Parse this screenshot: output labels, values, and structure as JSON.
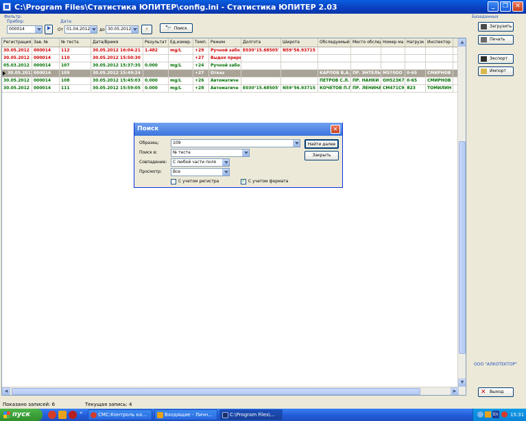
{
  "window": {
    "title": "C:\\Program Files\\Статистика ЮПИТЕР\\config.ini - Статистика ЮПИТЕР 2.03"
  },
  "filters": {
    "filter_label": "Фильтр:",
    "device_label": "Прибор:",
    "device_value": "000014",
    "date_label": "Дата:",
    "from_label": "От",
    "from_value": "01.04.2012",
    "to_label": "до",
    "to_value": "30.05.2012",
    "search_button": "Поиск"
  },
  "grid": {
    "columns": [
      "Регистрация",
      "Зав. №",
      "№ теста",
      "Дата/Время",
      "Результат",
      "Ед.измер.",
      "Темп.",
      "Режим",
      "Долгота",
      "Широта",
      "Обследуемый",
      "Место обслед.",
      "Номер ма",
      "Нагрузк",
      "Инспектор"
    ],
    "rows": [
      {
        "style": "red",
        "cells": [
          "30.05.2012",
          "000014",
          "112",
          "30.05.2012 16:04:21",
          "1.482",
          "mg/L",
          "+29",
          "Ручной забо",
          "E030°15.68505'",
          "N59°56.93715",
          "",
          "",
          "",
          "",
          ""
        ]
      },
      {
        "style": "red",
        "cells": [
          "30.05.2012",
          "000014",
          "110",
          "30.05.2012 15:50:30",
          "",
          "",
          "+27",
          "Выдох прерв",
          "",
          "",
          "",
          "",
          "",
          "",
          ""
        ]
      },
      {
        "style": "green",
        "cells": [
          "05.03.2012",
          "000014",
          "107",
          "30.05.2012 15:37:35",
          "0.000",
          "mg/L",
          "+24",
          "Ручной забо",
          "",
          "",
          "",
          "",
          "",
          "",
          ""
        ]
      },
      {
        "style": "selected",
        "cells": [
          "30.05.2012",
          "000014",
          "109",
          "30.05.2012 15:49:24",
          "",
          "",
          "+27",
          "Отказ",
          "",
          "",
          "КАРПОВ В.А.",
          "ПР. ЭНТЕЛЬ",
          "М570ОО",
          "0-65",
          "СМИРНОВ"
        ]
      },
      {
        "style": "green",
        "cells": [
          "30.05.2012",
          "000014",
          "108",
          "30.05.2012 15:45:03",
          "0.000",
          "mg/L",
          "+26",
          "Автоматиче",
          "",
          "",
          "ПЕТРОВ С.Л.",
          "ПР. НАНКИ З",
          "ОН523К78",
          "0-65",
          "СМИРНОВ"
        ]
      },
      {
        "style": "green",
        "cells": [
          "30.05.2012",
          "000014",
          "111",
          "30.05.2012 15:59:05",
          "0.000",
          "mg/L",
          "+28",
          "Автоматиче",
          "E030°15.68505'",
          "N59°56.93715",
          "КОЧЕТОВ П.Г",
          "ПР. ЛЕНИНА",
          "СМ471С98",
          "Я23",
          "ТОМИЛИН"
        ]
      }
    ]
  },
  "sidebar": {
    "db_label": "Базаданных",
    "load_button": "Загрузить",
    "print_button": "Печать",
    "export_button": "Экспорт",
    "import_button": "Импорт",
    "company": "ООО \"АЛКОТЕКТОР\"",
    "exit_button": "Выход"
  },
  "status": {
    "records": "Показано записей: 6",
    "current": "Текущая запись: 4"
  },
  "dialog": {
    "title": "Поиск",
    "pattern_label": "Образец:",
    "pattern_value": "109",
    "search_in_label": "Поиск в:",
    "search_in_value": "№ теста",
    "match_label": "Совпадение:",
    "match_value": "С любой части поля",
    "view_label": "Просмотр:",
    "view_value": "Все",
    "case_label": "С учетом регистра",
    "case_checked": false,
    "format_label": "С учетом формата",
    "format_checked": true,
    "find_next": "Найти далее",
    "close": "Закрыть"
  },
  "taskbar": {
    "start": "пуск",
    "tasks": [
      "СМС:Контроль ка...",
      "Входящие - Личн...",
      "C:\\Program Files\\..."
    ],
    "lang": "En",
    "clock": "15:31"
  }
}
